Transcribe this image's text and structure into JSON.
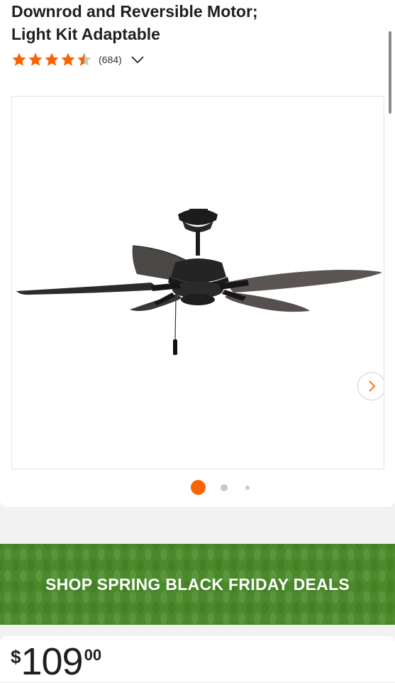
{
  "product": {
    "title_line1": "Downrod and Reversible Motor;",
    "title_line2": "Light Kit Adaptable",
    "rating": 4.5,
    "review_count": "(684)"
  },
  "gallery": {
    "image_icon": "ceiling-fan-image",
    "next_icon": "chevron-right-icon",
    "dots_total": 3,
    "active_dot": 1
  },
  "banner": {
    "text": "SHOP SPRING BLACK FRIDAY DEALS"
  },
  "price": {
    "currency": "$",
    "dollars": "109",
    "cents": "00"
  },
  "colors": {
    "accent": "#f96302",
    "banner_green": "#4b8a2b",
    "text": "#1f1f1f"
  }
}
